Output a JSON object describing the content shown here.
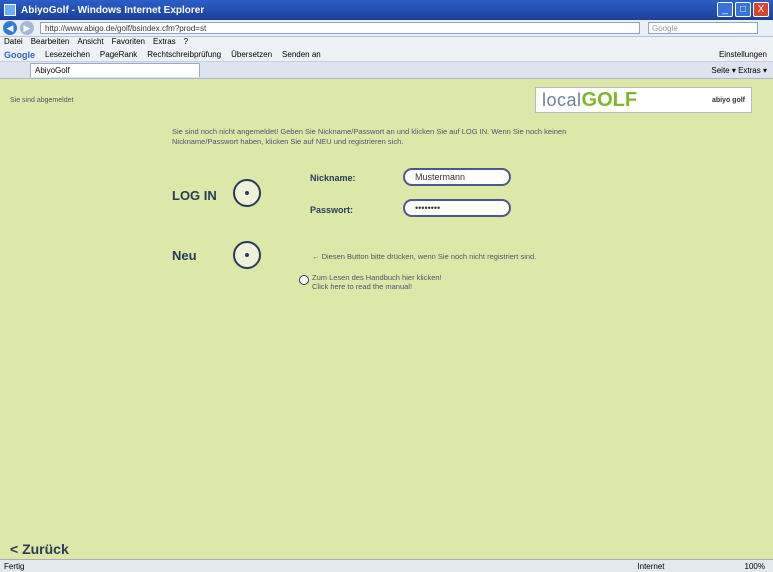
{
  "window": {
    "title": "AbiyoGolf - Windows Internet Explorer",
    "min": "_",
    "max": "□",
    "close": "X"
  },
  "address": {
    "url": "http://www.abigo.de/golf/bsindex.cfm?prod=st",
    "search_placeholder": "Google"
  },
  "menu": [
    "Datei",
    "Bearbeiten",
    "Ansicht",
    "Favoriten",
    "Extras",
    "?"
  ],
  "googlebar": {
    "logo": "Google",
    "items": [
      "Lesezeichen",
      "PageRank",
      "Rechtschreibprüfung",
      "Übersetzen",
      "Senden an"
    ],
    "settings": "Einstellungen"
  },
  "tab": {
    "label": "AbiyoGolf",
    "tools": "Seite ▾  Extras ▾"
  },
  "page": {
    "login_status": "Sie sind abgemeldet",
    "logo": {
      "local": "local",
      "golf": "GOLF",
      "tag": "abiyo golf"
    },
    "intro": "Sie sind noch nicht angemeldet! Geben Sie Nickname/Passwort an und klicken Sie auf LOG IN. Wenn Sie noch keinen Nickname/Passwort haben, klicken Sie auf NEU und registrieren sich.",
    "login_label": "LOG IN",
    "nickname_label": "Nickname:",
    "nickname_value": "Mustermann",
    "password_label": "Passwort:",
    "password_value": "••••••••",
    "new_label": "Neu",
    "new_hint": "← Diesen Button bitte drücken, wenn Sie noch nicht registriert sind.",
    "manual_de": "Zum Lesen des Handbuch hier klicken!",
    "manual_en": "Click here to read the manual!",
    "back": "< Zurück"
  },
  "status": {
    "left": "Fertig",
    "zone": "Internet",
    "zoom": "100%"
  }
}
